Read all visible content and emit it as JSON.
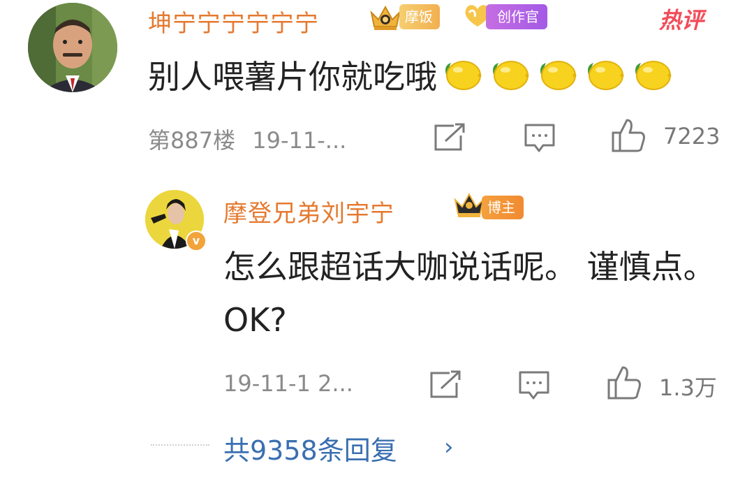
{
  "top_comment": {
    "username": "坤宁宁宁宁宁宁",
    "badge_fan": "摩饭",
    "badge_creator": "创作官",
    "hot_label": "热评",
    "text": "别人喂薯片你就吃哦",
    "emoji_name": "lemon-emoji",
    "emoji_count": 5,
    "floor": "第887楼",
    "date": "19-11-...",
    "like_count": "7223"
  },
  "reply": {
    "username": "摩登兄弟刘宇宁",
    "badge_role": "博主",
    "text": "怎么跟超话大咖说话呢。 谨慎点。OK?",
    "date": "19-11-1 2...",
    "like_count": "1.3万"
  },
  "total_replies": {
    "label": "共9358条回复",
    "chevron": "›"
  },
  "colors": {
    "username": "#e5792f",
    "link": "#3a6fb0",
    "hot": "#f24c5a",
    "meta": "#8a8a8a"
  }
}
